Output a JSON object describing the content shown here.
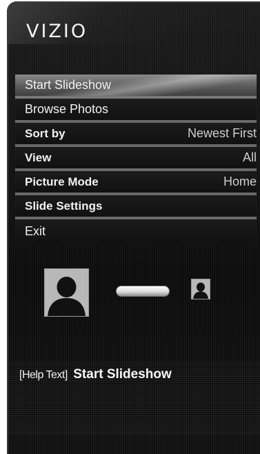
{
  "header": {
    "logo_text": "VIZIO"
  },
  "menu": {
    "items": [
      {
        "label": "Start Slideshow",
        "value": ""
      },
      {
        "label": "Browse Photos",
        "value": ""
      },
      {
        "label": "Sort by",
        "value": "Newest First"
      },
      {
        "label": "View",
        "value": "All"
      },
      {
        "label": "Picture Mode",
        "value": "Home"
      },
      {
        "label": "Slide Settings",
        "value": ""
      },
      {
        "label": "Exit",
        "value": ""
      }
    ],
    "selected_index": 0
  },
  "preview": {
    "large_thumb_icon": "person-silhouette-icon",
    "small_thumb_icon": "person-silhouette-icon"
  },
  "help": {
    "prefix": "[Help Text]",
    "text": "Start Slideshow"
  },
  "colors": {
    "background": "#0f0f0f",
    "selected_row": "#6f6f6f",
    "divider": "#6a6a6a",
    "text": "#f2f2f2",
    "thumbnail": "#b5b5b5"
  }
}
